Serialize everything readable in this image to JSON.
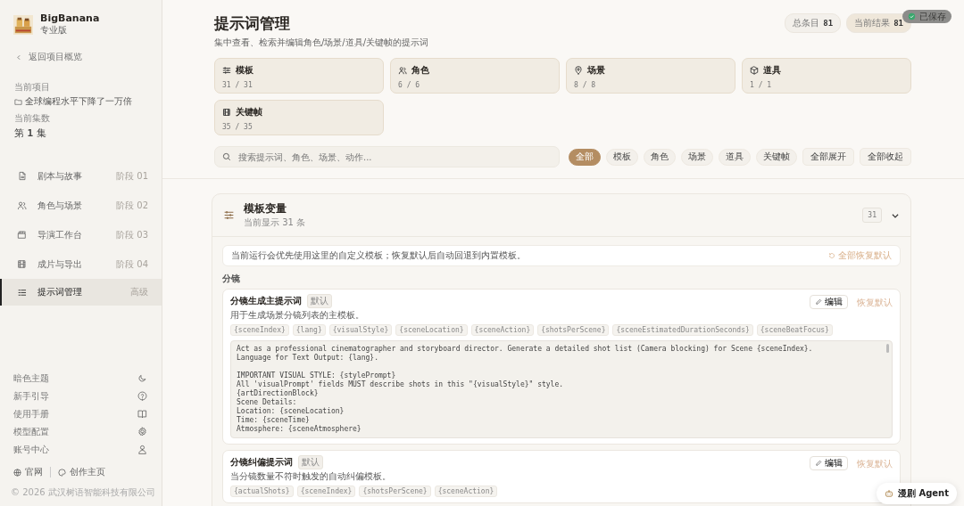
{
  "brand": {
    "name": "BigBanana",
    "edition": "专业版"
  },
  "back_link": "返回项目概览",
  "project": {
    "label": "当前项目",
    "name": "全球编程水平下降了一万倍",
    "episode_label": "当前集数",
    "episode_prefix": "第",
    "episode_number": "1",
    "episode_suffix": "集"
  },
  "nav": [
    {
      "label": "剧本与故事",
      "stage": "阶段 01",
      "selected": false
    },
    {
      "label": "角色与场景",
      "stage": "阶段 02",
      "selected": false
    },
    {
      "label": "导演工作台",
      "stage": "阶段 03",
      "selected": false
    },
    {
      "label": "成片与导出",
      "stage": "阶段 04",
      "selected": false
    },
    {
      "label": "提示词管理",
      "stage": "高级",
      "selected": true
    }
  ],
  "utilities": [
    {
      "label": "暗色主题"
    },
    {
      "label": "新手引导"
    },
    {
      "label": "使用手册"
    },
    {
      "label": "模型配置"
    },
    {
      "label": "账号中心"
    }
  ],
  "links": [
    {
      "label": "官网"
    },
    {
      "label": "创作主页"
    }
  ],
  "copyright": "© 2026 武汉树语智能科技有限公司",
  "header": {
    "title": "提示词管理",
    "subtitle": "集中查看、检索并编辑角色/场景/道具/关键帧的提示词",
    "toast": "已保存",
    "stats": [
      {
        "label": "总条目",
        "value": "81",
        "selected": false
      },
      {
        "label": "当前结果",
        "value": "81",
        "selected": true
      }
    ]
  },
  "categories": [
    {
      "label": "模板",
      "count": "31 / 31"
    },
    {
      "label": "角色",
      "count": "6 / 6"
    },
    {
      "label": "场景",
      "count": "8 / 8"
    },
    {
      "label": "道具",
      "count": "1 / 1"
    },
    {
      "label": "关键帧",
      "count": "35 / 35"
    }
  ],
  "search": {
    "placeholder": "搜索提示词、角色、场景、动作..."
  },
  "filters": [
    {
      "label": "全部",
      "selected": true
    },
    {
      "label": "模板",
      "selected": false
    },
    {
      "label": "角色",
      "selected": false
    },
    {
      "label": "场景",
      "selected": false
    },
    {
      "label": "道具",
      "selected": false
    },
    {
      "label": "关键帧",
      "selected": false
    }
  ],
  "actions": [
    "全部展开",
    "全部收起"
  ],
  "section": {
    "title": "模板变量",
    "subtitle": "当前显示 31 条",
    "count": "31",
    "expanded": true,
    "notice": "当前运行会优先使用这里的自定义模板；恢复默认后自动回退到内置模板。",
    "restore_all": "全部恢复默认",
    "group": "分镜",
    "templates": [
      {
        "title": "分镜生成主提示词",
        "badge": "默认",
        "description": "用于生成场景分镜列表的主模板。",
        "edit": "编辑",
        "restore": "恢复默认",
        "variables": [
          "{sceneIndex}",
          "{lang}",
          "{visualStyle}",
          "{sceneLocation}",
          "{sceneAction}",
          "{shotsPerScene}",
          "{sceneEstimatedDurationSeconds}",
          "{sceneBeatFocus}"
        ],
        "body": "Act as a professional cinematographer and storyboard director. Generate a detailed shot list (Camera blocking) for Scene {sceneIndex}.\nLanguage for Text Output: {lang}.\n\nIMPORTANT VISUAL STYLE: {stylePrompt}\nAll 'visualPrompt' fields MUST describe shots in this \"{visualStyle}\" style.\n{artDirectionBlock}\nScene Details:\nLocation: {sceneLocation}\nTime: {sceneTime}\nAtmosphere: {sceneAtmosphere}"
      },
      {
        "title": "分镜纠偏提示词",
        "badge": "默认",
        "description": "当分镜数量不符时触发的自动纠偏模板。",
        "edit": "编辑",
        "restore": "恢复默认",
        "variables": [
          "{actualShots}",
          "{sceneIndex}",
          "{shotsPerScene}",
          "{sceneAction}"
        ]
      }
    ]
  },
  "agent_button": "漫剧 Agent"
}
